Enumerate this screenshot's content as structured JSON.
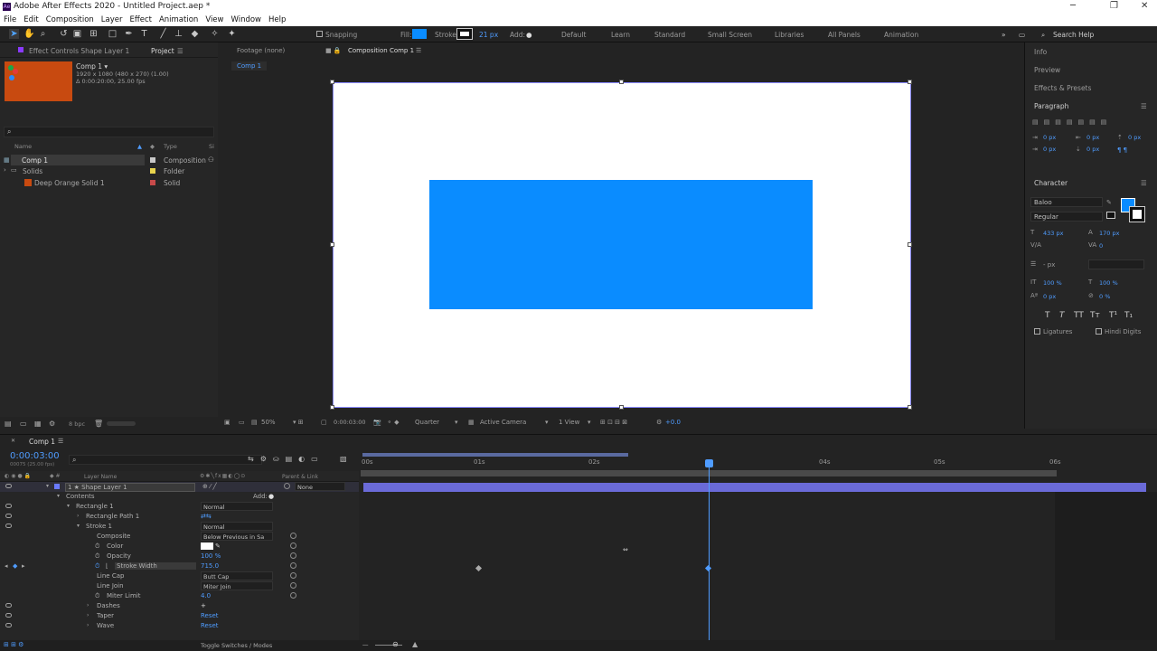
{
  "app": {
    "title": "Adobe After Effects 2020 - Untitled Project.aep *",
    "logo": "Ae"
  },
  "menu": [
    "File",
    "Edit",
    "Composition",
    "Layer",
    "Effect",
    "Animation",
    "View",
    "Window",
    "Help"
  ],
  "toolbar": {
    "snapping": "Snapping",
    "fill": "Fill:",
    "stroke": "Stroke:",
    "stroke_px": "21 px",
    "add": "Add:",
    "fill_color": "#0a8cff",
    "workspaces": [
      "Default",
      "Learn",
      "Standard",
      "Small Screen",
      "Libraries",
      "All Panels",
      "Animation"
    ],
    "search": "Search Help"
  },
  "left_panel": {
    "tab_effect": "Effect Controls Shape Layer 1",
    "tab_project": "Project",
    "comp_name": "Comp 1 ▾",
    "comp_info1": "1920 x 1080  (480 x 270) (1.00)",
    "comp_info2": "Δ 0:00:20:00, 25.00 fps",
    "col_name": "Name",
    "col_type": "Type",
    "col_extra": "Si",
    "rows": [
      {
        "name": "Comp 1",
        "type": "Composition",
        "color": "#c8c8c8"
      },
      {
        "name": "Solids",
        "type": "Folder",
        "color": "#e8d44d"
      },
      {
        "name": "Deep Orange Solid 1",
        "type": "Solid",
        "color": "#c84a4a"
      }
    ],
    "bpc": "8 bpc"
  },
  "viewer": {
    "tab_footage": "Footage (none)",
    "tab_comp": "Composition Comp 1",
    "crumb": "Comp 1",
    "zoom": "50%",
    "time": "0:00:03:00",
    "resolution": "Quarter",
    "camera": "Active Camera",
    "views": "1 View",
    "exposure": "+0.0",
    "shape_color": "#0a8cff"
  },
  "right_panel": {
    "info": "Info",
    "preview": "Preview",
    "effects": "Effects & Presets",
    "paragraph": "Paragraph",
    "px_vals": [
      "0 px",
      "0 px",
      "0 px",
      "0 px",
      "0 px"
    ],
    "character": "Character",
    "font": "Baloo",
    "style": "Regular",
    "font_size": "433 px",
    "leading": "170 px",
    "tracking": "0",
    "stroke_px": "- px",
    "vscale": "100 %",
    "hscale": "100 %",
    "baseline": "0 px",
    "tsume": "0 %",
    "type_styles": [
      "T",
      "T",
      "TT",
      "Tт",
      "T¹",
      "T₁"
    ],
    "ligatures": "Ligatures",
    "hindi": "Hindi Digits",
    "char_color": "#0a8cff"
  },
  "timeline": {
    "tab": "Comp 1",
    "timecode": "0:00:03:00",
    "frames": "00075 (25.00 fps)",
    "layer_name_hdr": "Layer Name",
    "parent_hdr": "Parent & Link",
    "ruler": [
      "00s",
      "01s",
      "02s",
      "04s",
      "05s",
      "06s"
    ],
    "footer": "Toggle Switches / Modes",
    "rows": [
      {
        "label": "1    ★ Shape Layer 1",
        "right": "None"
      },
      {
        "label": "Contents",
        "right": "Add:"
      },
      {
        "label": "Rectangle 1",
        "right": "Normal"
      },
      {
        "label": "Rectangle Path 1",
        "right": ""
      },
      {
        "label": "Stroke 1",
        "right": "Normal"
      },
      {
        "label": "Composite",
        "right": "Below Previous in Sa"
      },
      {
        "label": "Color",
        "right": ""
      },
      {
        "label": "Opacity",
        "right": "100 %"
      },
      {
        "label": "Stroke Width",
        "right": "715.0"
      },
      {
        "label": "Line Cap",
        "right": "Butt Cap"
      },
      {
        "label": "Line Join",
        "right": "Miter Join"
      },
      {
        "label": "Miter Limit",
        "right": "4.0"
      },
      {
        "label": "Dashes",
        "right": "+"
      },
      {
        "label": "Taper",
        "right": "Reset"
      },
      {
        "label": "Wave",
        "right": "Reset"
      }
    ]
  }
}
